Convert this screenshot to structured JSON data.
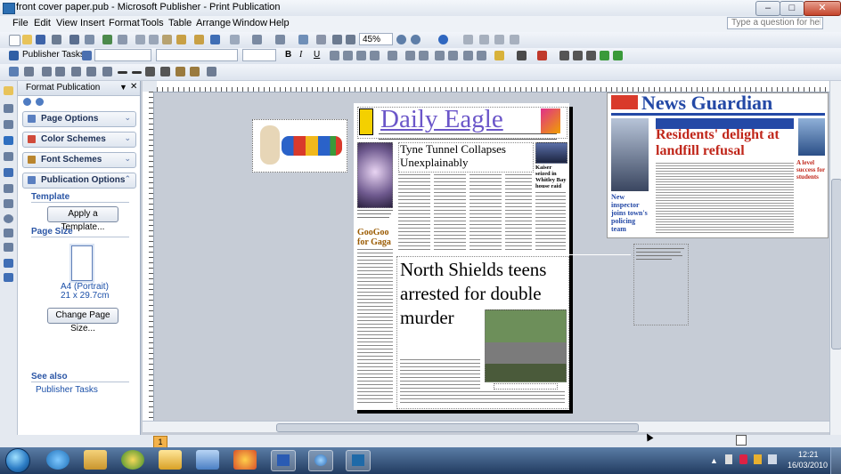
{
  "window": {
    "title": "front cover paper.pub - Microsoft Publisher - Print Publication",
    "controls": {
      "minimize": "–",
      "maximize": "□",
      "close": "✕"
    }
  },
  "menu": {
    "items": [
      "File",
      "Edit",
      "View",
      "Insert",
      "Format",
      "Tools",
      "Table",
      "Arrange",
      "Window",
      "Help"
    ],
    "help_placeholder": "Type a question for help"
  },
  "toolbar": {
    "zoom": "45%",
    "tasks_label": "Publisher Tasks",
    "bold": "B",
    "italic": "I",
    "underline": "U"
  },
  "task_pane": {
    "title": "Format Publication",
    "sections": [
      "Page Options",
      "Color Schemes",
      "Font Schemes",
      "Publication Options"
    ],
    "template_heading": "Template",
    "apply_template": "Apply a Template...",
    "page_size_heading": "Page Size",
    "page_size_name": "A4 (Portrait)",
    "page_size_dims": "21 x 29.7cm",
    "change_page_size": "Change Page Size...",
    "see_also": "See also",
    "see_also_link": "Publisher Tasks"
  },
  "publication": {
    "masthead": "Daily Eagle",
    "headline1": "Tyne Tunnel Collapses Unexplainably",
    "side_heading": "GooGoo for Gaga",
    "side_story": "Kaiser seized in Whitley Bay house raid",
    "headline2": "North Shields teens arrested for double murder",
    "reference_masthead": "News Guardian",
    "reference_headline": "Residents' delight at landfill refusal",
    "reference_sub": "New inspector joins town's policing team",
    "reference_side": "A level success for students"
  },
  "page_nav": {
    "page": "1"
  },
  "taskbar": {
    "time": "12:21",
    "date": "16/03/2010"
  }
}
